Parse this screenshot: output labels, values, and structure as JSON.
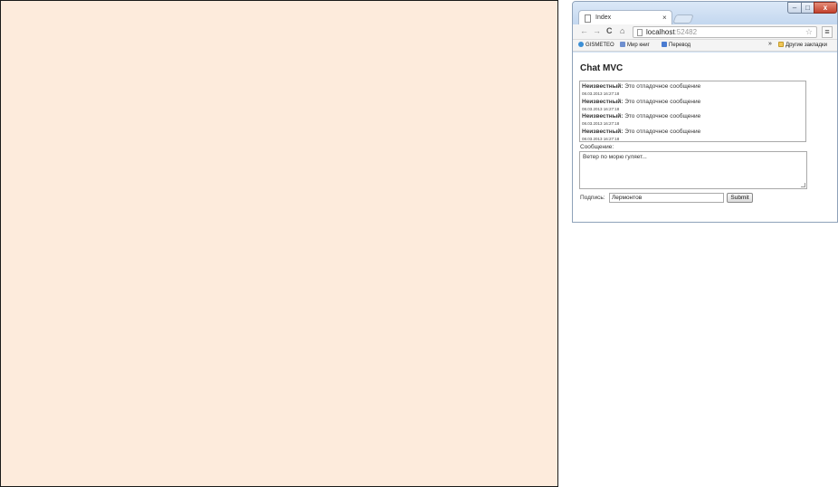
{
  "browser": {
    "tab_title": "Index",
    "tab_close": "×",
    "url_host": "localhost",
    "url_port": ":52482",
    "window_buttons": {
      "minimize": "–",
      "maximize": "□",
      "close": "x"
    },
    "nav": {
      "back": "←",
      "forward": "→",
      "reload": "C",
      "home": "⌂"
    },
    "star": "☆",
    "menu": "≡"
  },
  "bookmarks": {
    "items": [
      {
        "label": "GISMETEO"
      },
      {
        "label": "Мир книг"
      },
      {
        "label": "Перевод"
      }
    ],
    "more": "»",
    "other_label": "Другие закладки"
  },
  "page": {
    "title": "Chat MVC",
    "messages": [
      {
        "author": "Неизвестный:",
        "text": "Это отладочное сообщение",
        "timestamp": "08.03.2013 16:27:18"
      },
      {
        "author": "Неизвестный:",
        "text": "Это отладочное сообщение",
        "timestamp": "08.03.2013 16:27:18"
      },
      {
        "author": "Неизвестный:",
        "text": "Это отладочное сообщение",
        "timestamp": "08.03.2013 16:27:18"
      },
      {
        "author": "Неизвестный:",
        "text": "Это отладочное сообщение",
        "timestamp": "08.03.2013 16:27:18"
      }
    ],
    "message_label": "Сообщение:",
    "message_value": "Ветер по морю гуляет...",
    "signature_label": "Подпись:",
    "signature_value": "Лермонтов",
    "submit_label": "Submit"
  },
  "colors": {
    "left_panel_bg": "#fdebdc",
    "window_frame": "#cfe0f4"
  }
}
